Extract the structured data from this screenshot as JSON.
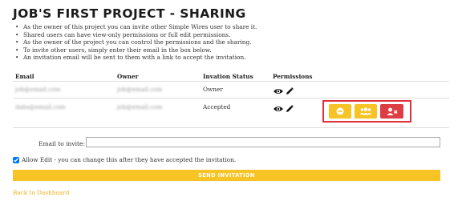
{
  "page": {
    "title": "JOB'S FIRST PROJECT - SHARING"
  },
  "info_items": [
    "As the owner of this project you can invite other Simple Wires user to share it.",
    "Shared users can have view-only permissions or full edit permissions.",
    "As the owner of the project you can control the permissions and the sharing.",
    "To invite other users, simply enter their email in the box below.",
    "An invitation email will be sent to them with a link to accept the invitation."
  ],
  "table": {
    "headers": {
      "email": "Email",
      "owner": "Owner",
      "status": "Invation Status",
      "permissions": "Permissions"
    },
    "rows": [
      {
        "email": "job@email.com",
        "owner": "job@email.com",
        "status": "Owner",
        "permission_icons": [
          "eye-icon",
          "pencil-icon"
        ]
      },
      {
        "email": "dabs@email.com",
        "owner": "job@email.com",
        "status": "Accepted",
        "permission_icons": [
          "eye-icon",
          "pencil-icon"
        ],
        "actions": [
          "minus-circle-icon",
          "users-icon",
          "remove-user-icon"
        ]
      }
    ]
  },
  "invite": {
    "label": "Email to invite:",
    "value": "",
    "placeholder": ""
  },
  "allow_edit": {
    "checked": true,
    "label": "Allow Edit - you can change this after they have accepted the invitation."
  },
  "send_button": {
    "label": "SEND INVITATION"
  },
  "back_link": {
    "label": "Back to Dashboard"
  },
  "colors": {
    "accent_yellow": "#f7c325",
    "danger_red": "#dd3e44",
    "highlight_border": "#e0303a",
    "link": "#f0b21c"
  }
}
